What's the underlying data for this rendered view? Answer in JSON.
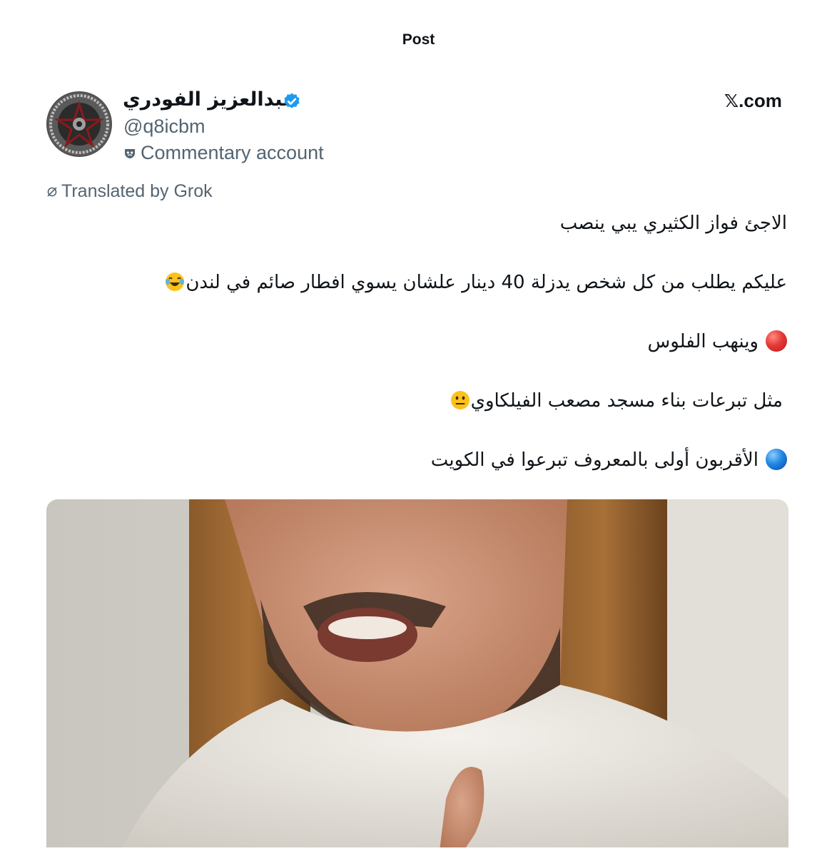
{
  "header": {
    "title": "Post"
  },
  "author": {
    "display_name": "عبدالعزيز الفودري",
    "handle": "@q8icbm",
    "badge_label": "Commentary account",
    "verified_color": "#1d9bf0"
  },
  "source": {
    "site": ".com",
    "logo_glyph": "𝕏"
  },
  "translation": {
    "label": "Translated by Grok"
  },
  "tweet": {
    "line1": "الاجئ فواز الكثيري يبي ينصب",
    "line2": "عليكم يطلب من كل شخص يدزلة 40 دينار علشان يسوي افطار صائم في لندن",
    "line3": "وينهب الفلوس",
    "line4": "مثل تبرعات بناء مسجد مصعب الفيلكاوي",
    "line5": "الأقربون أولى بالمعروف تبرعوا في الكويت"
  },
  "media": {
    "type": "video-frame"
  }
}
